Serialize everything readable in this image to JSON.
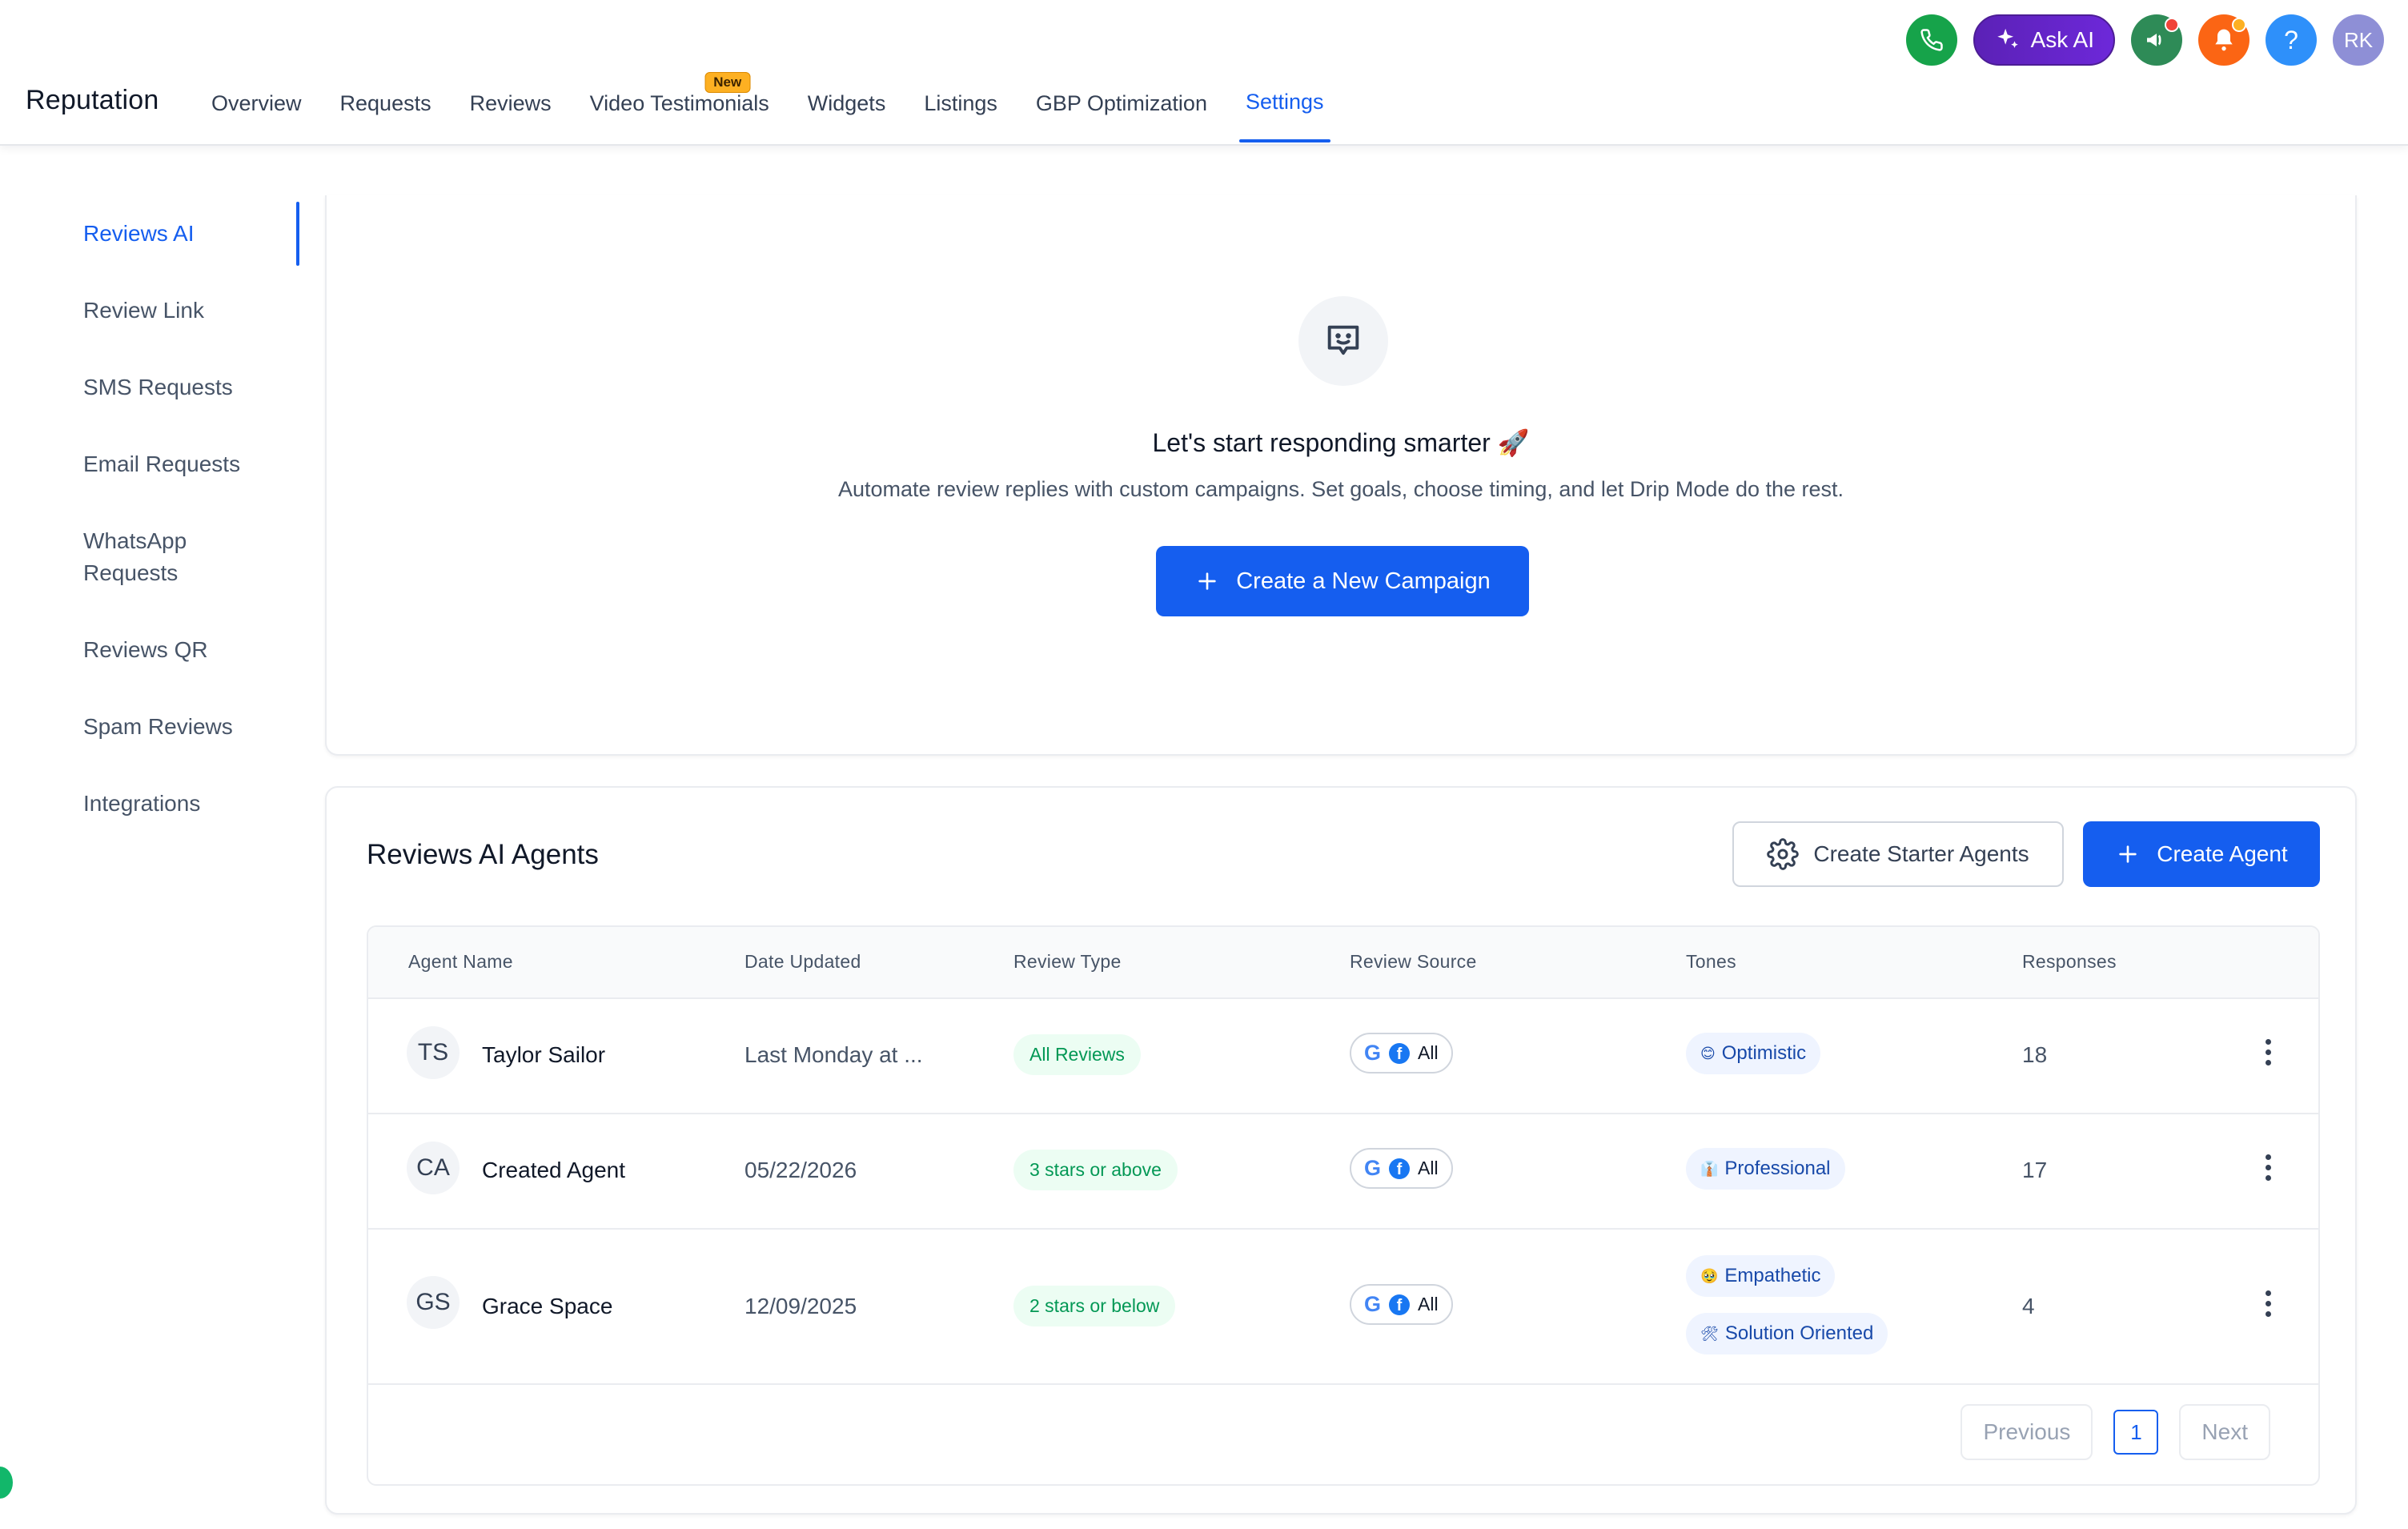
{
  "header": {
    "brand": "Reputation",
    "nav": [
      {
        "label": "Overview"
      },
      {
        "label": "Requests"
      },
      {
        "label": "Reviews"
      },
      {
        "label": "Video Testimonials",
        "badge": "New"
      },
      {
        "label": "Widgets"
      },
      {
        "label": "Listings"
      },
      {
        "label": "GBP Optimization"
      },
      {
        "label": "Settings",
        "active": true
      }
    ],
    "actions": {
      "ask_ai": "Ask AI",
      "help": "?",
      "avatar": "RK",
      "icons": [
        "phone-icon",
        "sparkle-icon",
        "megaphone-icon",
        "bell-icon",
        "help-icon"
      ]
    }
  },
  "sidebar": {
    "items": [
      {
        "label": "Reviews AI",
        "active": true
      },
      {
        "label": "Review Link"
      },
      {
        "label": "SMS Requests"
      },
      {
        "label": "Email Requests"
      },
      {
        "label": "WhatsApp Requests"
      },
      {
        "label": "Reviews QR"
      },
      {
        "label": "Spam Reviews"
      },
      {
        "label": "Integrations"
      }
    ]
  },
  "hero": {
    "title": "Let's start responding smarter 🚀",
    "subtitle": "Automate review replies with custom campaigns. Set goals, choose timing, and let Drip Mode do the rest.",
    "button": "Create a New Campaign"
  },
  "agents": {
    "title": "Reviews AI Agents",
    "starter_button": "Create Starter Agents",
    "create_button": "Create Agent",
    "columns": [
      "Agent Name",
      "Date Updated",
      "Review Type",
      "Review Source",
      "Tones",
      "Responses"
    ],
    "rows": [
      {
        "initials": "TS",
        "name": "Taylor Sailor",
        "date": "Last Monday at ...",
        "review_type": "All Reviews",
        "source": "All",
        "tones": [
          {
            "emoji": "😊",
            "label": "Optimistic"
          }
        ],
        "responses": "18"
      },
      {
        "initials": "CA",
        "name": "Created Agent",
        "date": "05/22/2026",
        "review_type": "3 stars or above",
        "source": "All",
        "tones": [
          {
            "emoji": "👔",
            "label": "Professional"
          }
        ],
        "responses": "17"
      },
      {
        "initials": "GS",
        "name": "Grace Space",
        "date": "12/09/2025",
        "review_type": "2 stars or below",
        "source": "All",
        "tones": [
          {
            "emoji": "🥹",
            "label": "Empathetic"
          },
          {
            "emoji": "🛠",
            "label": "Solution Oriented"
          }
        ],
        "responses": "4"
      }
    ],
    "pagination": {
      "previous": "Previous",
      "page": "1",
      "next": "Next"
    }
  },
  "colors": {
    "primary": "#155eef",
    "success_bg": "#ecfdf3",
    "success_text": "#039855",
    "tone_bg": "#eff4ff",
    "ask_ai": "#5b21b6"
  }
}
